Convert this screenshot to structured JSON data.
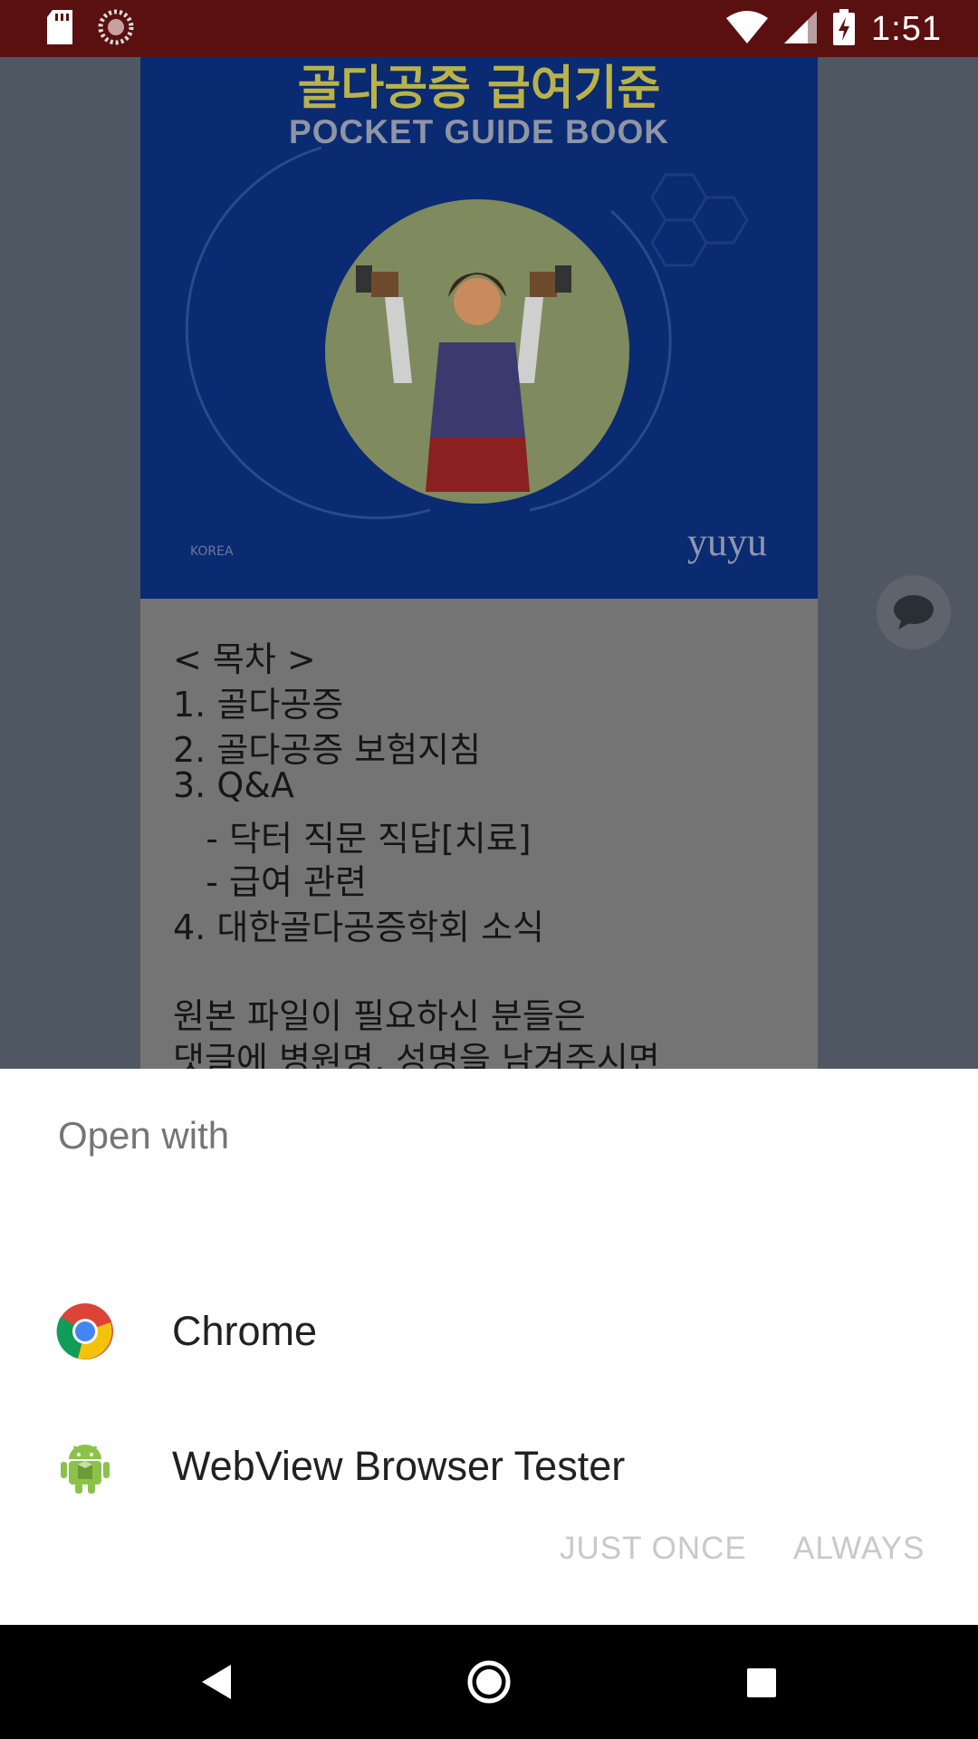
{
  "status_bar": {
    "time": "1:51",
    "icons": [
      "sd-card-icon",
      "loading-icon",
      "wifi-icon",
      "signal-icon",
      "battery-charging-icon"
    ]
  },
  "background_content": {
    "poster_title": "골다공증 급여기준",
    "poster_subtitle": "POCKET GUIDE BOOK",
    "poster_logo": "yuyu",
    "text_lines": [
      "< 목차 >",
      "1. 골다공증",
      "2. 골다공증 보험지침",
      "3. Q&A",
      "   - 닥터 직문 직답[치료]",
      "   - 급여 관련",
      "4. 대한골다공증학회 소식",
      "",
      "원본 파일이 필요하신 분들은",
      "댓글에 병원명, 성명을 남겨주시면"
    ]
  },
  "sheet": {
    "title": "Open with",
    "apps": [
      {
        "label": "Chrome",
        "icon": "chrome-icon"
      },
      {
        "label": "WebView Browser Tester",
        "icon": "android-icon"
      }
    ],
    "just_once_label": "JUST ONCE",
    "always_label": "ALWAYS"
  },
  "colors": {
    "status_bar": "#5b1010",
    "scrim": "#4f5862",
    "sheet_bg": "#ffffff",
    "disabled_button_text": "#c9c9c9",
    "nav_bar": "#000000"
  },
  "nav_bar": {
    "buttons": [
      "back-icon",
      "home-icon",
      "recents-icon"
    ]
  }
}
